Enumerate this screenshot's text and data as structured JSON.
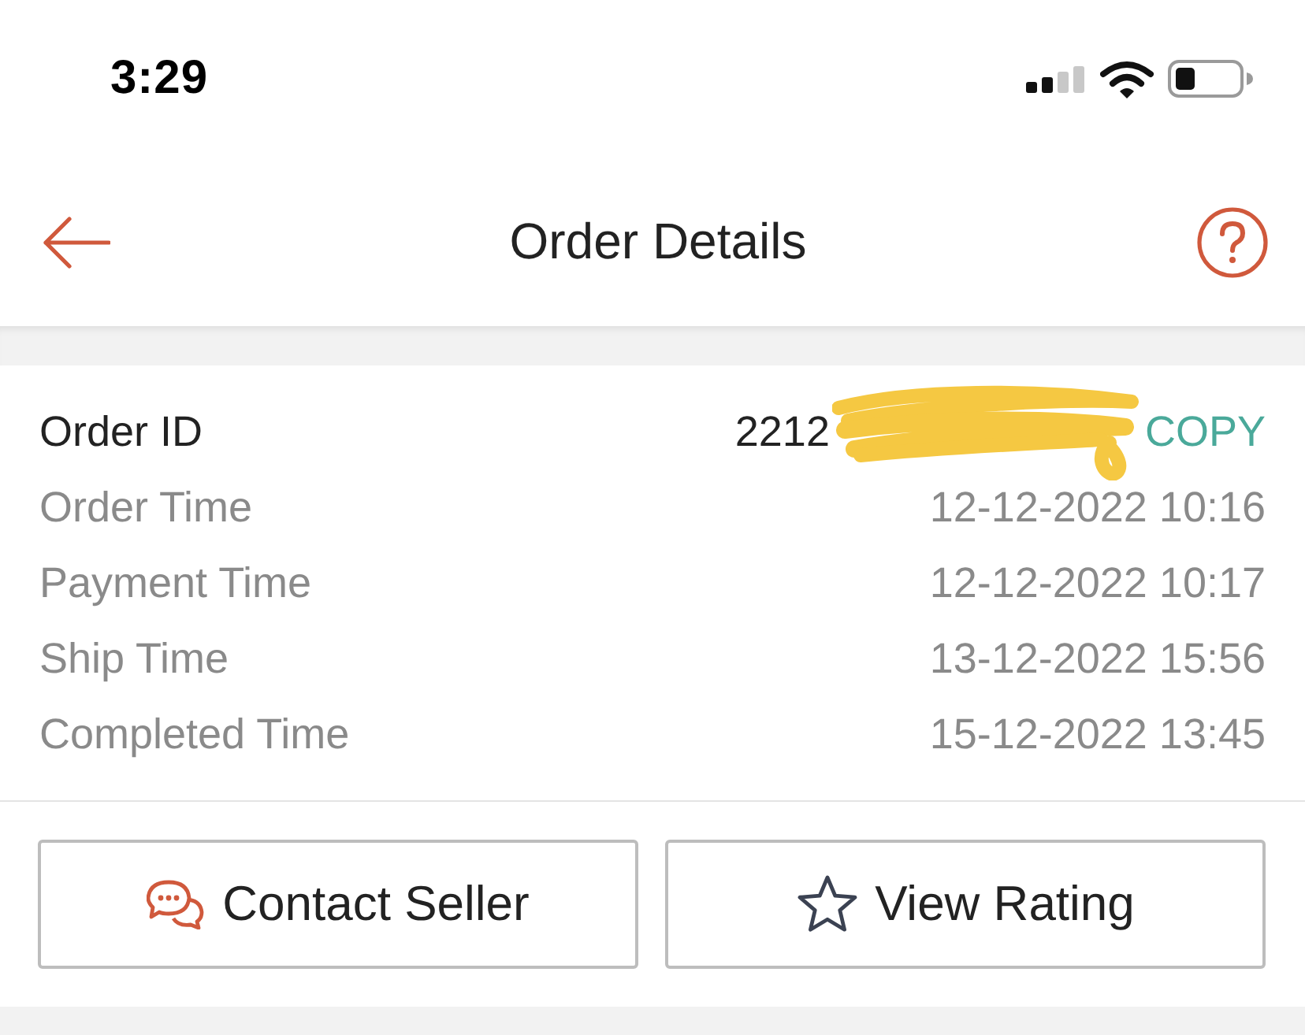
{
  "status_bar": {
    "time": "3:29"
  },
  "header": {
    "title": "Order Details"
  },
  "order_info": {
    "rows": [
      {
        "kind": "id",
        "label": "Order ID",
        "value": "2212",
        "redacted": true,
        "action": "COPY"
      },
      {
        "kind": "time",
        "label": "Order Time",
        "value": "12-12-2022 10:16"
      },
      {
        "kind": "time",
        "label": "Payment Time",
        "value": "12-12-2022 10:17"
      },
      {
        "kind": "time",
        "label": "Ship Time",
        "value": "13-12-2022 15:56"
      },
      {
        "kind": "time",
        "label": "Completed Time",
        "value": "15-12-2022 13:45"
      }
    ]
  },
  "buttons": [
    {
      "kind": "contact",
      "label": "Contact Seller"
    },
    {
      "kind": "rating",
      "label": "View Rating"
    }
  ]
}
